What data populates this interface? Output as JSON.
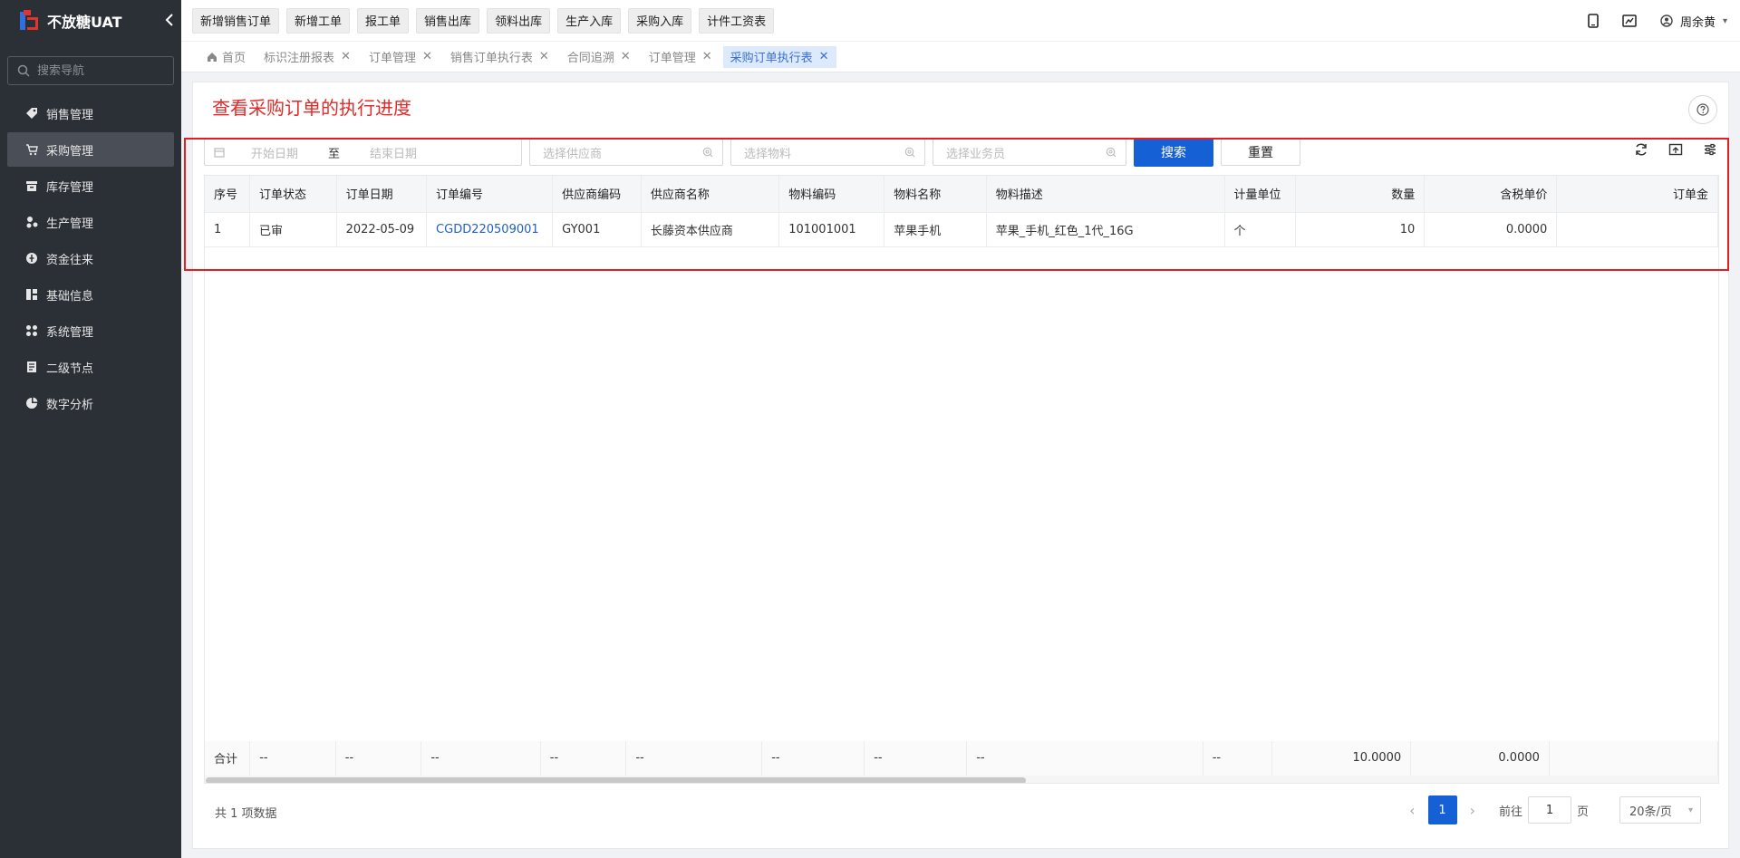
{
  "app": {
    "title": "不放糖UAT",
    "collapse_icon": "chevron-left-icon"
  },
  "sidebar": {
    "search_placeholder": "搜索导航",
    "items": [
      {
        "label": "销售管理",
        "icon": "tag-icon"
      },
      {
        "label": "采购管理",
        "icon": "cart-icon",
        "active": true
      },
      {
        "label": "库存管理",
        "icon": "warehouse-icon"
      },
      {
        "label": "生产管理",
        "icon": "production-icon"
      },
      {
        "label": "资金往来",
        "icon": "money-icon"
      },
      {
        "label": "基础信息",
        "icon": "chart-icon"
      },
      {
        "label": "系统管理",
        "icon": "apps-icon"
      },
      {
        "label": "二级节点",
        "icon": "document-icon"
      },
      {
        "label": "数字分析",
        "icon": "pie-icon"
      }
    ]
  },
  "topbar": {
    "quick_buttons": [
      "新增销售订单",
      "新增工单",
      "报工单",
      "销售出库",
      "领料出库",
      "生产入库",
      "采购入库",
      "计件工资表"
    ],
    "user_name": "周余黄"
  },
  "tabs": [
    {
      "label": "首页",
      "icon": "home-icon",
      "closable": false
    },
    {
      "label": "标识注册报表",
      "closable": true
    },
    {
      "label": "订单管理",
      "closable": true
    },
    {
      "label": "销售订单执行表",
      "closable": true
    },
    {
      "label": "合同追溯",
      "closable": true
    },
    {
      "label": "订单管理",
      "closable": true
    },
    {
      "label": "采购订单执行表",
      "closable": true,
      "active": true
    }
  ],
  "page": {
    "title": "查看采购订单的执行进度"
  },
  "filters": {
    "start_date_placeholder": "开始日期",
    "range_separator": "至",
    "end_date_placeholder": "结束日期",
    "supplier_placeholder": "选择供应商",
    "material_placeholder": "选择物料",
    "salesman_placeholder": "选择业务员",
    "search_label": "搜索",
    "reset_label": "重置"
  },
  "table": {
    "columns": [
      "序号",
      "订单状态",
      "订单日期",
      "订单编号",
      "供应商编码",
      "供应商名称",
      "物料编码",
      "物料名称",
      "物料描述",
      "计量单位",
      "数量",
      "含税单价",
      "订单金"
    ],
    "rows": [
      [
        "1",
        "已审",
        "2022-05-09",
        "CGDD220509001",
        "GY001",
        "长藤资本供应商",
        "101001001",
        "苹果手机",
        "苹果_手机_红色_1代_16G",
        "个",
        "10",
        "0.0000",
        ""
      ]
    ],
    "summary": [
      "合计",
      "--",
      "--",
      "--",
      "--",
      "--",
      "--",
      "--",
      "--",
      "--",
      "10.0000",
      "0.0000",
      ""
    ]
  },
  "pagination": {
    "total_text": "共 1 项数据",
    "current_page": "1",
    "goto_prefix": "前往",
    "goto_value": "1",
    "goto_suffix": "页",
    "page_size": "20条/页"
  },
  "colors": {
    "primary": "#1560d4",
    "annotation_red": "#e02020",
    "sidebar_bg": "#2b2f36"
  }
}
